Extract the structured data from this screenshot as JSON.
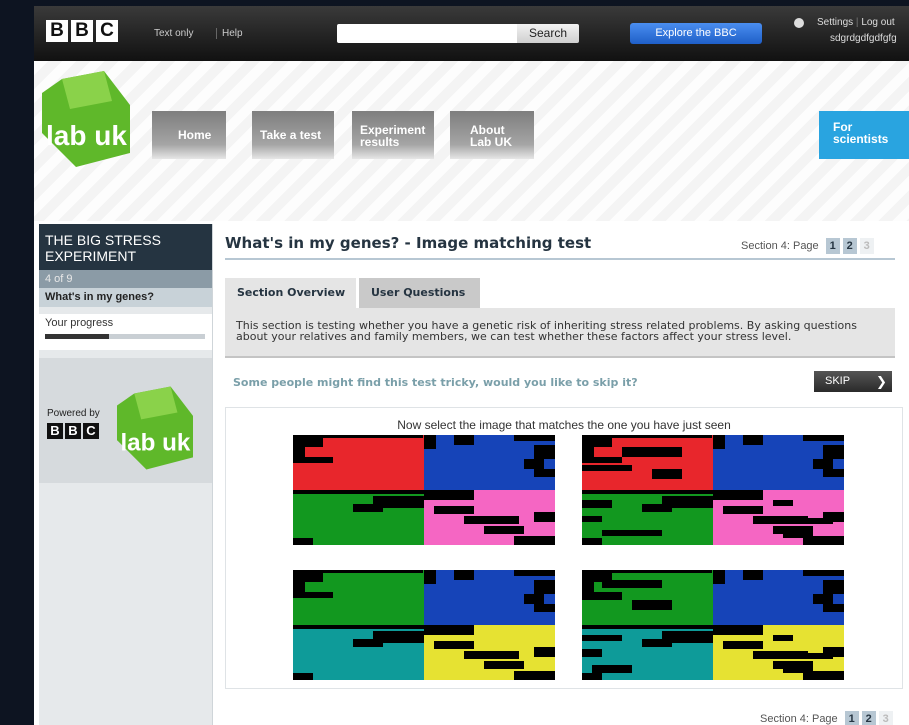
{
  "topbar": {
    "logo_letters": [
      "B",
      "B",
      "C"
    ],
    "text_only": "Text only",
    "help": "Help",
    "search_placeholder": "",
    "search_button": "Search",
    "explore": "Explore the BBC",
    "settings": "Settings",
    "log_out": "Log out",
    "username": "sdgrdgdfgdfgfg"
  },
  "masthead": {
    "logo_text": "lab uk",
    "nav": [
      {
        "label": "Home"
      },
      {
        "label": "Take a test"
      },
      {
        "label": "Experiment results"
      },
      {
        "label": "About Lab UK"
      }
    ],
    "for_scientists": "For scientists"
  },
  "sidebar": {
    "title": "THE BIG STRESS EXPERIMENT",
    "count": "4 of 9",
    "section": "What's in my genes?",
    "progress_label": "Your progress",
    "progress_fraction": 0.4,
    "powered_by": "Powered by"
  },
  "main": {
    "title": "What's in my genes? - Image matching test",
    "pager_label": "Section 4: Page",
    "pages": [
      "1",
      "2",
      "3"
    ],
    "tabs": [
      {
        "label": "Section Overview"
      },
      {
        "label": "User Questions"
      }
    ],
    "overview_text": "This section is testing whether you have a genetic risk of inheriting stress related problems. By asking questions about your relatives and family members, we can test whether these factors affect your stress level.",
    "skip_question": "Some people might find this test tricky, would you like to skip it?",
    "skip_label": "SKIP",
    "instruction": "Now select the image that matches the one you have just seen"
  },
  "colors": {
    "red": "#e8262c",
    "blue": "#1644b8",
    "green": "#12981f",
    "pink": "#f566c3",
    "teal": "#0e9b99",
    "yellow": "#e6e232",
    "black": "#000000",
    "labuk_green": "#5fb82a",
    "scientists_blue": "#29a4e0"
  },
  "image_options": [
    {
      "name": "option-1",
      "quadrants": [
        "red",
        "blue",
        "green",
        "pink"
      ]
    },
    {
      "name": "option-2",
      "quadrants": [
        "red",
        "blue",
        "green",
        "pink"
      ]
    },
    {
      "name": "option-3",
      "quadrants": [
        "green",
        "blue",
        "teal",
        "yellow"
      ]
    },
    {
      "name": "option-4",
      "quadrants": [
        "green",
        "blue",
        "teal",
        "yellow"
      ]
    }
  ]
}
